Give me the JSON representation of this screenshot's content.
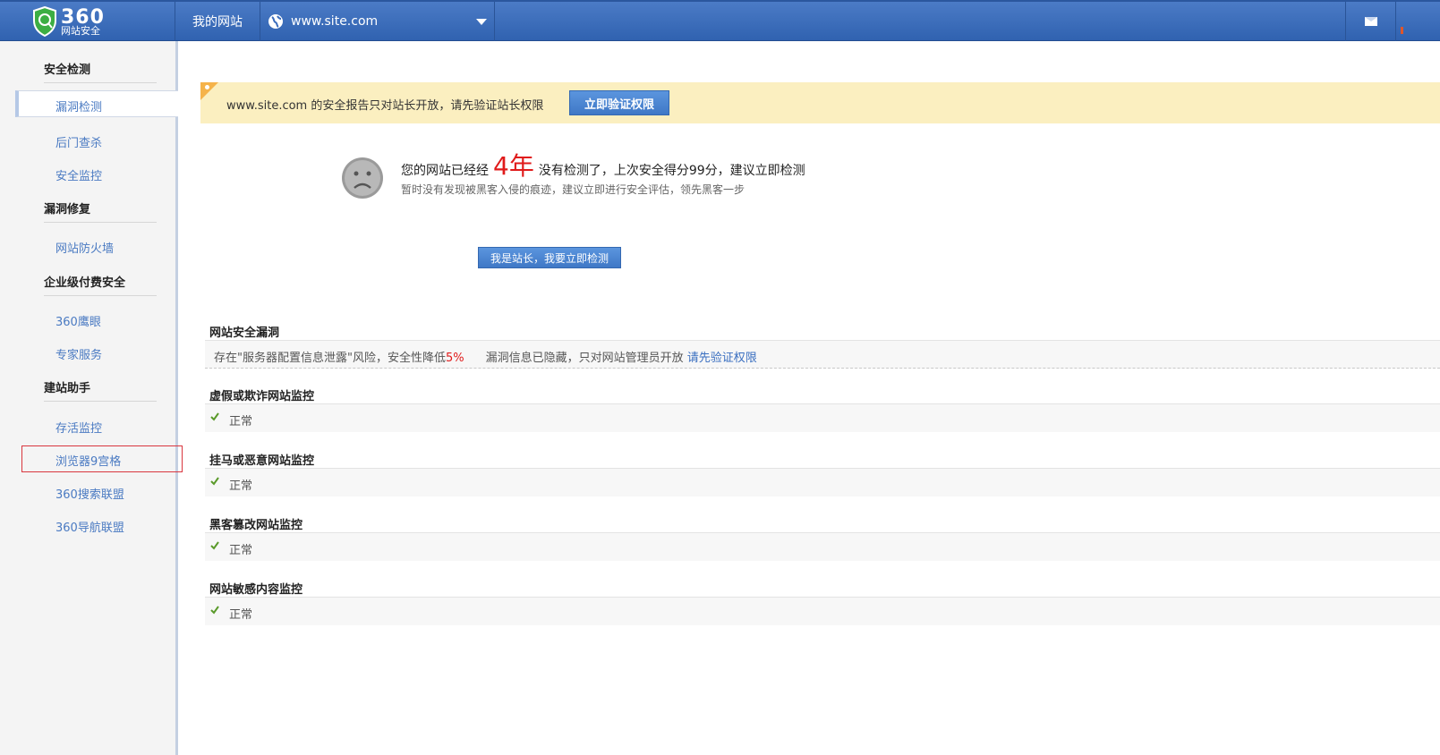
{
  "header": {
    "logo_big": "360",
    "logo_small": "网站安全",
    "my_site": "我的网站",
    "site_select": "www.site.com"
  },
  "sidebar": {
    "sections": [
      {
        "title": "安全检测",
        "items": [
          "漏洞检测",
          "后门查杀",
          "安全监控"
        ]
      },
      {
        "title": "漏洞修复",
        "items": [
          "网站防火墙"
        ]
      },
      {
        "title": "企业级付费安全",
        "items": [
          "360鹰眼",
          "专家服务"
        ]
      },
      {
        "title": "建站助手",
        "items": [
          "存活监控",
          "浏览器9宫格",
          "360搜索联盟",
          "360导航联盟"
        ]
      }
    ],
    "active_item": "漏洞检测",
    "highlighted_item": "浏览器9宫格"
  },
  "notice": {
    "text": "www.site.com 的安全报告只对站长开放，请先验证站长权限",
    "button": "立即验证权限"
  },
  "status": {
    "prefix": "您的网站已经经",
    "years": "4年",
    "suffix": "没有检测了，上次安全得分99分，建议立即检测",
    "sub": "暂时没有发现被黑客入侵的痕迹，建议立即进行安全评估，领先黑客一步",
    "check_button": "我是站长，我要立即检测"
  },
  "panels": {
    "vuln": {
      "title": "网站安全漏洞",
      "risk_prefix": "存在\"服务器配置信息泄露\"风险，安全性降低",
      "risk_pct": "5%",
      "hidden_note": "漏洞信息已隐藏，只对网站管理员开放",
      "verify_link": "请先验证权限"
    },
    "monitors": [
      {
        "title": "虚假或欺诈网站监控",
        "status": "正常"
      },
      {
        "title": "挂马或恶意网站监控",
        "status": "正常"
      },
      {
        "title": "黑客篡改网站监控",
        "status": "正常"
      },
      {
        "title": "网站敏感内容监控",
        "status": "正常"
      }
    ]
  },
  "colors": {
    "header_blue": "#3a6cbc",
    "link_blue": "#4a7ac2",
    "alert_red": "#e01b1b",
    "notice_bg": "#fbefc0",
    "check_green": "#5a9a2a"
  }
}
